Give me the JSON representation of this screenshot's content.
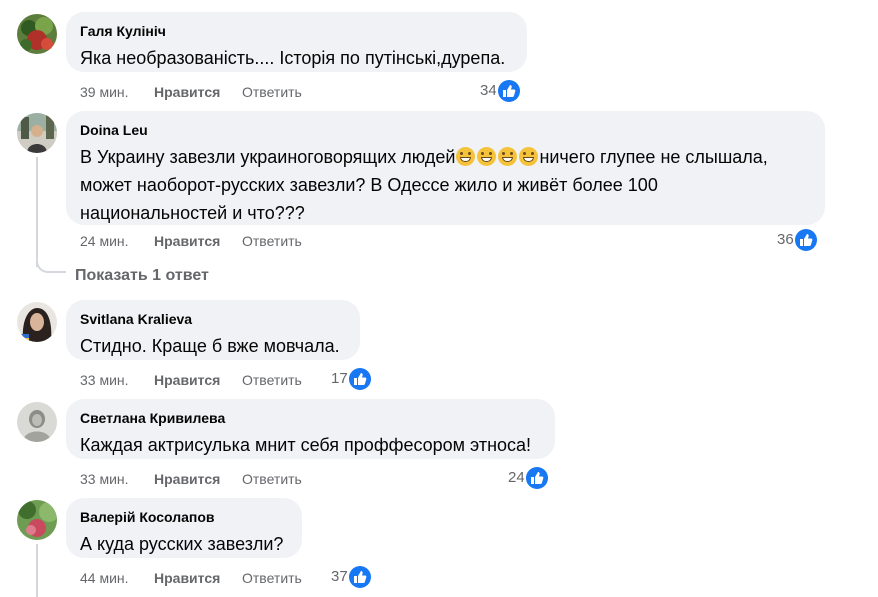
{
  "comments": [
    {
      "author": "Галя Кулініч",
      "text": "Яка необразованість.... Історія по путінські,дурепа.",
      "time": "39 мин.",
      "like_label": "Нравится",
      "reply_label": "Ответить",
      "reaction_count": "34",
      "avatar_color": "#3b6b2f"
    },
    {
      "author": "Doina Leu",
      "text_line1_prefix": "В Украину завезли украиноговорящих людей",
      "text_line1_suffix": "ничего глупее не слышала,",
      "text_line2": "может наоборот-русских завезли? В Одессе жило и живёт более 100",
      "text_line3": "национальностей и что???",
      "time": "24 мин.",
      "like_label": "Нравится",
      "reply_label": "Ответить",
      "reaction_count": "36",
      "avatar_color": "#7c7a6e",
      "more_replies_label": "Показать 1 ответ"
    },
    {
      "author": "Svitlana Kralieva",
      "text": "Стидно. Краще б вже мовчала.",
      "time": "33 мин.",
      "like_label": "Нравится",
      "reply_label": "Ответить",
      "reaction_count": "17",
      "avatar_color": "#4a3a34"
    },
    {
      "author": "Светлана Кривилева",
      "text": "Каждая актрисулька мнит себя проффесором этноса!",
      "time": "33 мин.",
      "like_label": "Нравится",
      "reply_label": "Ответить",
      "reaction_count": "24",
      "avatar_color": "#b9b9b4"
    },
    {
      "author": "Валерій Косолапов",
      "text": "А куда русских завезли?",
      "time": "44 мин.",
      "like_label": "Нравится",
      "reply_label": "Ответить",
      "reaction_count": "37",
      "avatar_color": "#4f7d3c"
    }
  ],
  "colors": {
    "bubble": "#f0f2f5",
    "meta_text": "#65676b",
    "like_badge": "#1877f2",
    "thread_line": "#d4d7db"
  },
  "icons": {
    "reaction": "thumbs-up-icon",
    "emoji": "grinning-face-emoji"
  }
}
